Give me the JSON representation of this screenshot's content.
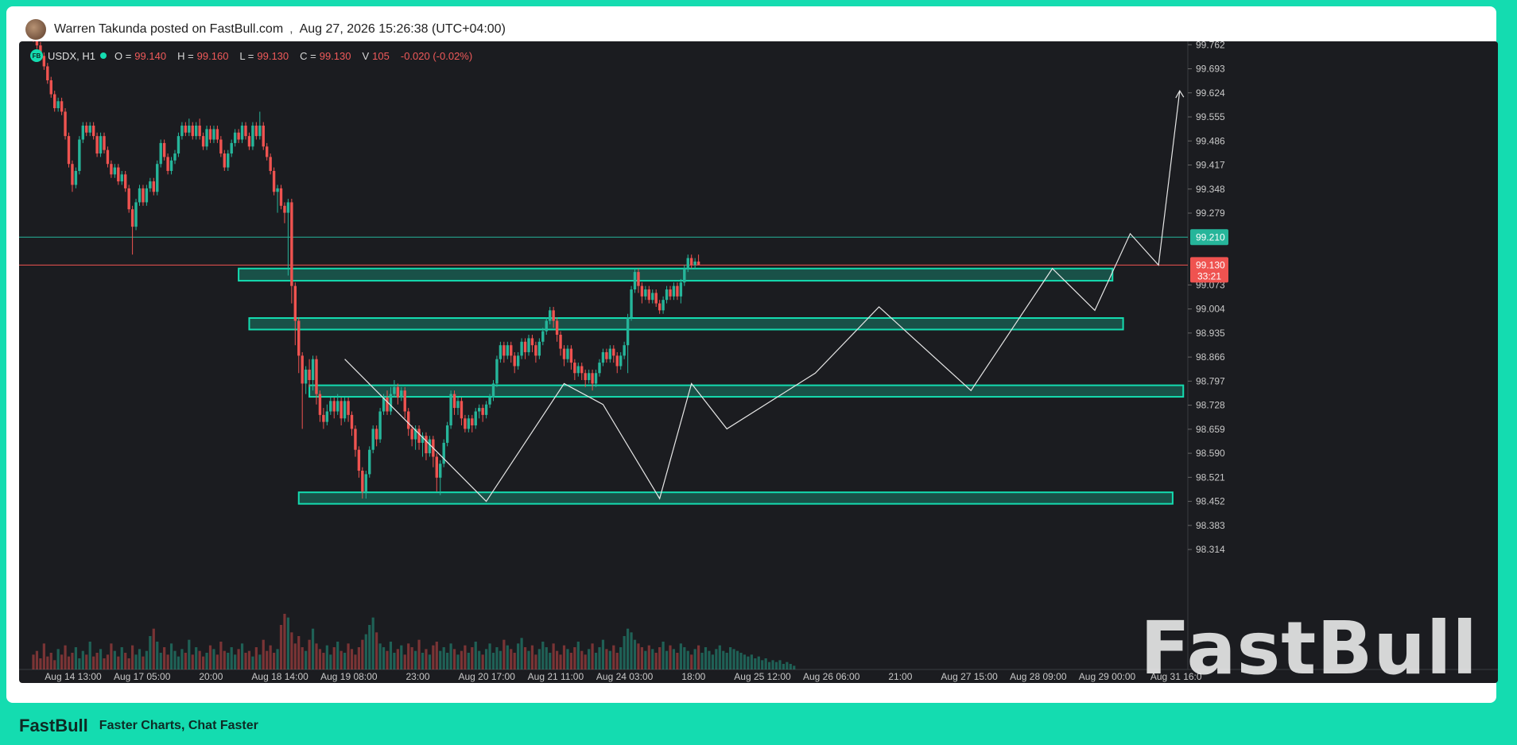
{
  "post": {
    "author_line": "Warren Takunda posted on FastBull.com",
    "separator": ",",
    "timestamp": "Aug 27, 2026 15:26:38 (UTC+04:00)"
  },
  "legend": {
    "symbol": "USDX, H1",
    "open_label": "O =",
    "open": "99.140",
    "high_label": "H =",
    "high": "99.160",
    "low_label": "L =",
    "low": "99.130",
    "close_label": "C =",
    "close": "99.130",
    "volume_label": "V",
    "volume": "105",
    "change": "-0.020 (-0.02%)"
  },
  "watermark": "FastBull",
  "footer": {
    "brand": "FastBull",
    "tagline": "Faster Charts, Chat Faster"
  },
  "colors": {
    "up": "#26b59a",
    "down": "#ef5350",
    "zone": "#14dcb0",
    "accent": "#14dcb0"
  },
  "chart_data": {
    "type": "candlestick",
    "symbol": "USDX",
    "interval": "H1",
    "y_ticks": [
      "99.762",
      "99.693",
      "99.624",
      "99.555",
      "99.486",
      "99.417",
      "99.348",
      "99.279",
      "99.073",
      "99.004",
      "98.935",
      "98.866",
      "98.797",
      "98.728",
      "98.659",
      "98.590",
      "98.521",
      "98.452",
      "98.383",
      "98.314"
    ],
    "ylim": [
      98.28,
      99.79
    ],
    "x_ticks": [
      "Aug 14 13:00",
      "Aug 17 05:00",
      "20:00",
      "Aug 18 14:00",
      "Aug 19 08:00",
      "23:00",
      "Aug 20 17:00",
      "Aug 21 11:00",
      "Aug 24 03:00",
      "18:00",
      "Aug 25 12:00",
      "Aug 26 06:00",
      "21:00",
      "Aug 27 15:00",
      "Aug 28 09:00",
      "Aug 29 00:00",
      "Aug 31 16:0"
    ],
    "price_lines": [
      {
        "value": 99.21,
        "label": "99.210",
        "color": "#26b59a"
      },
      {
        "value": 99.13,
        "label": "99.130",
        "sublabel": "33:21",
        "color": "#ef5350"
      }
    ],
    "zones": [
      {
        "from_bar": 58,
        "to_bar": 305,
        "low": 99.085,
        "high": 99.12
      },
      {
        "from_bar": 61,
        "to_bar": 308,
        "low": 98.945,
        "high": 98.978
      },
      {
        "from_bar": 78,
        "to_bar": 325,
        "low": 98.752,
        "high": 98.785
      },
      {
        "from_bar": 75,
        "to_bar": 322,
        "low": 98.445,
        "high": 98.478
      }
    ],
    "path": [
      [
        88,
        98.86
      ],
      [
        128,
        98.452
      ],
      [
        150,
        98.79
      ],
      [
        161,
        98.73
      ],
      [
        177,
        98.46
      ],
      [
        186,
        98.79
      ],
      [
        196,
        98.66
      ],
      [
        221,
        98.82
      ],
      [
        239,
        99.01
      ],
      [
        265,
        98.77
      ],
      [
        288,
        99.12
      ],
      [
        300,
        99.0
      ],
      [
        310,
        99.22
      ],
      [
        318,
        99.13
      ],
      [
        324,
        99.63
      ]
    ],
    "candles": [
      [
        99.8,
        99.78,
        99.81,
        99.77
      ],
      [
        99.78,
        99.76,
        99.79,
        99.75
      ],
      [
        99.76,
        99.73,
        99.77,
        99.72
      ],
      [
        99.73,
        99.7,
        99.74,
        99.69
      ],
      [
        99.7,
        99.66,
        99.71,
        99.65
      ],
      [
        99.66,
        99.62,
        99.67,
        99.61
      ],
      [
        99.62,
        99.58,
        99.63,
        99.57
      ],
      [
        99.58,
        99.6,
        99.61,
        99.57
      ],
      [
        99.6,
        99.57,
        99.61,
        99.56
      ],
      [
        99.57,
        99.5,
        99.58,
        99.49
      ],
      [
        99.5,
        99.42,
        99.51,
        99.41
      ],
      [
        99.42,
        99.36,
        99.43,
        99.34
      ],
      [
        99.36,
        99.4,
        99.41,
        99.35
      ],
      [
        99.4,
        99.49,
        99.5,
        99.39
      ],
      [
        99.49,
        99.53,
        99.54,
        99.48
      ],
      [
        99.53,
        99.51,
        99.54,
        99.5
      ],
      [
        99.51,
        99.53,
        99.54,
        99.5
      ],
      [
        99.53,
        99.5,
        99.54,
        99.49
      ],
      [
        99.5,
        99.45,
        99.51,
        99.44
      ],
      [
        99.45,
        99.5,
        99.51,
        99.44
      ],
      [
        99.5,
        99.46,
        99.51,
        99.45
      ],
      [
        99.46,
        99.42,
        99.47,
        99.41
      ],
      [
        99.42,
        99.39,
        99.43,
        99.38
      ],
      [
        99.39,
        99.41,
        99.42,
        99.38
      ],
      [
        99.41,
        99.37,
        99.42,
        99.36
      ],
      [
        99.37,
        99.39,
        99.4,
        99.36
      ],
      [
        99.39,
        99.35,
        99.4,
        99.34
      ],
      [
        99.35,
        99.29,
        99.36,
        99.28
      ],
      [
        99.29,
        99.24,
        99.3,
        99.16
      ],
      [
        99.24,
        99.31,
        99.32,
        99.23
      ],
      [
        99.31,
        99.35,
        99.36,
        99.3
      ],
      [
        99.35,
        99.31,
        99.36,
        99.3
      ],
      [
        99.31,
        99.35,
        99.36,
        99.3
      ],
      [
        99.35,
        99.37,
        99.38,
        99.34
      ],
      [
        99.37,
        99.34,
        99.38,
        99.33
      ],
      [
        99.34,
        99.42,
        99.43,
        99.33
      ],
      [
        99.42,
        99.48,
        99.49,
        99.41
      ],
      [
        99.48,
        99.44,
        99.49,
        99.43
      ],
      [
        99.44,
        99.4,
        99.45,
        99.39
      ],
      [
        99.4,
        99.43,
        99.44,
        99.39
      ],
      [
        99.43,
        99.45,
        99.46,
        99.42
      ],
      [
        99.45,
        99.5,
        99.51,
        99.44
      ],
      [
        99.5,
        99.53,
        99.54,
        99.49
      ],
      [
        99.53,
        99.51,
        99.54,
        99.5
      ],
      [
        99.51,
        99.53,
        99.55,
        99.5
      ],
      [
        99.53,
        99.5,
        99.54,
        99.49
      ],
      [
        99.5,
        99.53,
        99.54,
        99.49
      ],
      [
        99.53,
        99.5,
        99.55,
        99.49
      ],
      [
        99.5,
        99.47,
        99.51,
        99.46
      ],
      [
        99.47,
        99.52,
        99.53,
        99.46
      ],
      [
        99.52,
        99.49,
        99.53,
        99.48
      ],
      [
        99.49,
        99.52,
        99.53,
        99.48
      ],
      [
        99.52,
        99.49,
        99.53,
        99.48
      ],
      [
        99.49,
        99.45,
        99.5,
        99.44
      ],
      [
        99.45,
        99.41,
        99.46,
        99.4
      ],
      [
        99.41,
        99.45,
        99.46,
        99.4
      ],
      [
        99.45,
        99.48,
        99.49,
        99.44
      ],
      [
        99.48,
        99.51,
        99.52,
        99.47
      ],
      [
        99.51,
        99.49,
        99.52,
        99.48
      ],
      [
        99.49,
        99.53,
        99.54,
        99.48
      ],
      [
        99.53,
        99.5,
        99.54,
        99.49
      ],
      [
        99.5,
        99.47,
        99.51,
        99.46
      ],
      [
        99.47,
        99.53,
        99.54,
        99.46
      ],
      [
        99.53,
        99.5,
        99.54,
        99.49
      ],
      [
        99.5,
        99.53,
        99.57,
        99.49
      ],
      [
        99.53,
        99.47,
        99.54,
        99.46
      ],
      [
        99.47,
        99.44,
        99.48,
        99.43
      ],
      [
        99.44,
        99.4,
        99.45,
        99.39
      ],
      [
        99.4,
        99.34,
        99.41,
        99.33
      ],
      [
        99.34,
        99.35,
        99.36,
        99.28
      ],
      [
        99.35,
        99.3,
        99.36,
        99.29
      ],
      [
        99.3,
        99.28,
        99.31,
        99.25
      ],
      [
        99.28,
        99.31,
        99.32,
        99.1
      ],
      [
        99.31,
        99.07,
        99.32,
        99.02
      ],
      [
        99.07,
        98.97,
        99.08,
        98.9
      ],
      [
        98.97,
        98.87,
        98.98,
        98.82
      ],
      [
        98.87,
        98.79,
        98.88,
        98.66
      ],
      [
        98.79,
        98.83,
        98.84,
        98.76
      ],
      [
        98.83,
        98.8,
        98.86,
        98.78
      ],
      [
        98.8,
        98.86,
        98.87,
        98.77
      ],
      [
        98.86,
        98.76,
        98.87,
        98.73
      ],
      [
        98.76,
        98.7,
        98.77,
        98.68
      ],
      [
        98.7,
        98.68,
        98.72,
        98.66
      ],
      [
        98.68,
        98.71,
        98.73,
        98.67
      ],
      [
        98.71,
        98.74,
        98.75,
        98.7
      ],
      [
        98.74,
        98.71,
        98.75,
        98.69
      ],
      [
        98.71,
        98.74,
        98.76,
        98.7
      ],
      [
        98.74,
        98.69,
        98.75,
        98.67
      ],
      [
        98.69,
        98.74,
        98.75,
        98.68
      ],
      [
        98.74,
        98.7,
        98.75,
        98.68
      ],
      [
        98.7,
        98.66,
        98.71,
        98.64
      ],
      [
        98.66,
        98.6,
        98.67,
        98.58
      ],
      [
        98.6,
        98.54,
        98.61,
        98.52
      ],
      [
        98.54,
        98.48,
        98.55,
        98.46
      ],
      [
        98.48,
        98.53,
        98.54,
        98.46
      ],
      [
        98.53,
        98.6,
        98.61,
        98.52
      ],
      [
        98.6,
        98.66,
        98.67,
        98.59
      ],
      [
        98.66,
        98.63,
        98.67,
        98.61
      ],
      [
        98.63,
        98.71,
        98.72,
        98.62
      ],
      [
        98.71,
        98.75,
        98.76,
        98.7
      ],
      [
        98.75,
        98.71,
        98.77,
        98.7
      ],
      [
        98.71,
        98.76,
        98.78,
        98.7
      ],
      [
        98.76,
        98.78,
        98.8,
        98.75
      ],
      [
        98.78,
        98.75,
        98.79,
        98.73
      ],
      [
        98.75,
        98.77,
        98.78,
        98.74
      ],
      [
        98.77,
        98.71,
        98.78,
        98.69
      ],
      [
        98.71,
        98.66,
        98.72,
        98.64
      ],
      [
        98.66,
        98.63,
        98.67,
        98.61
      ],
      [
        98.63,
        98.66,
        98.67,
        98.6
      ],
      [
        98.66,
        98.62,
        98.67,
        98.6
      ],
      [
        98.62,
        98.64,
        98.65,
        98.58
      ],
      [
        98.64,
        98.59,
        98.65,
        98.57
      ],
      [
        98.59,
        98.63,
        98.64,
        98.58
      ],
      [
        98.63,
        98.58,
        98.64,
        98.55
      ],
      [
        98.58,
        98.52,
        98.59,
        98.48
      ],
      [
        98.52,
        98.56,
        98.57,
        98.47
      ],
      [
        98.56,
        98.62,
        98.63,
        98.55
      ],
      [
        98.62,
        98.67,
        98.68,
        98.61
      ],
      [
        98.67,
        98.76,
        98.77,
        98.66
      ],
      [
        98.76,
        98.72,
        98.77,
        98.7
      ],
      [
        98.72,
        98.74,
        98.75,
        98.7
      ],
      [
        98.74,
        98.69,
        98.75,
        98.67
      ],
      [
        98.69,
        98.66,
        98.7,
        98.65
      ],
      [
        98.66,
        98.69,
        98.7,
        98.65
      ],
      [
        98.69,
        98.67,
        98.7,
        98.65
      ],
      [
        98.67,
        98.71,
        98.72,
        98.66
      ],
      [
        98.71,
        98.72,
        98.73,
        98.69
      ],
      [
        98.72,
        98.7,
        98.73,
        98.68
      ],
      [
        98.7,
        98.73,
        98.74,
        98.69
      ],
      [
        98.73,
        98.75,
        98.76,
        98.72
      ],
      [
        98.75,
        98.79,
        98.8,
        98.74
      ],
      [
        98.79,
        98.86,
        98.87,
        98.78
      ],
      [
        98.86,
        98.9,
        98.91,
        98.85
      ],
      [
        98.9,
        98.87,
        98.91,
        98.85
      ],
      [
        98.87,
        98.9,
        98.91,
        98.86
      ],
      [
        98.9,
        98.87,
        98.91,
        98.85
      ],
      [
        98.87,
        98.84,
        98.88,
        98.82
      ],
      [
        98.84,
        98.87,
        98.88,
        98.83
      ],
      [
        98.87,
        98.91,
        98.92,
        98.86
      ],
      [
        98.91,
        98.88,
        98.92,
        98.86
      ],
      [
        98.88,
        98.92,
        98.93,
        98.87
      ],
      [
        98.92,
        98.9,
        98.93,
        98.88
      ],
      [
        98.9,
        98.87,
        98.91,
        98.85
      ],
      [
        98.87,
        98.91,
        98.92,
        98.86
      ],
      [
        98.91,
        98.94,
        98.95,
        98.9
      ],
      [
        98.94,
        98.97,
        98.98,
        98.93
      ],
      [
        98.97,
        99.0,
        99.01,
        98.96
      ],
      [
        99.0,
        98.97,
        99.01,
        98.95
      ],
      [
        98.97,
        98.93,
        98.98,
        98.91
      ],
      [
        98.93,
        98.89,
        98.94,
        98.87
      ],
      [
        98.89,
        98.86,
        98.9,
        98.84
      ],
      [
        98.86,
        98.89,
        98.9,
        98.85
      ],
      [
        98.89,
        98.85,
        98.9,
        98.83
      ],
      [
        98.85,
        98.82,
        98.86,
        98.8
      ],
      [
        98.82,
        98.84,
        98.85,
        98.81
      ],
      [
        98.84,
        98.82,
        98.85,
        98.8
      ],
      [
        98.82,
        98.8,
        98.83,
        98.78
      ],
      [
        98.8,
        98.82,
        98.83,
        98.79
      ],
      [
        98.82,
        98.79,
        98.83,
        98.77
      ],
      [
        98.79,
        98.82,
        98.83,
        98.78
      ],
      [
        98.82,
        98.85,
        98.86,
        98.81
      ],
      [
        98.85,
        98.88,
        98.89,
        98.84
      ],
      [
        98.88,
        98.86,
        98.89,
        98.85
      ],
      [
        98.86,
        98.89,
        98.9,
        98.85
      ],
      [
        98.89,
        98.87,
        98.9,
        98.85
      ],
      [
        98.87,
        98.84,
        98.88,
        98.82
      ],
      [
        98.84,
        98.87,
        98.88,
        98.83
      ],
      [
        98.87,
        98.9,
        98.91,
        98.86
      ],
      [
        98.9,
        98.98,
        98.99,
        98.82
      ],
      [
        98.98,
        99.06,
        99.07,
        98.97
      ],
      [
        99.06,
        99.11,
        99.12,
        99.05
      ],
      [
        99.11,
        99.07,
        99.12,
        99.05
      ],
      [
        99.07,
        99.04,
        99.08,
        99.02
      ],
      [
        99.04,
        99.06,
        99.07,
        99.03
      ],
      [
        99.06,
        99.03,
        99.07,
        99.02
      ],
      [
        99.03,
        99.05,
        99.06,
        99.02
      ],
      [
        99.05,
        99.02,
        99.06,
        99.01
      ],
      [
        99.02,
        99.0,
        99.03,
        98.99
      ],
      [
        99.0,
        99.03,
        99.04,
        98.99
      ],
      [
        99.03,
        99.06,
        99.07,
        99.02
      ],
      [
        99.06,
        99.04,
        99.07,
        99.03
      ],
      [
        99.04,
        99.07,
        99.08,
        99.03
      ],
      [
        99.07,
        99.04,
        99.08,
        99.03
      ],
      [
        99.04,
        99.08,
        99.09,
        99.02
      ],
      [
        99.08,
        99.12,
        99.13,
        99.07
      ],
      [
        99.12,
        99.15,
        99.16,
        99.11
      ],
      [
        99.15,
        99.13,
        99.16,
        99.12
      ],
      [
        99.13,
        99.14,
        99.15,
        99.12
      ],
      [
        99.14,
        99.13,
        99.16,
        99.13
      ]
    ],
    "volume": [
      8,
      10,
      6,
      14,
      7,
      9,
      5,
      11,
      8,
      13,
      7,
      9,
      12,
      6,
      10,
      8,
      15,
      7,
      9,
      11,
      6,
      8,
      14,
      10,
      7,
      12,
      9,
      6,
      13,
      8,
      11,
      7,
      10,
      18,
      22,
      15,
      9,
      12,
      8,
      14,
      10,
      7,
      11,
      9,
      16,
      8,
      12,
      10,
      7,
      9,
      13,
      11,
      8,
      15,
      10,
      9,
      12,
      8,
      11,
      14,
      9,
      10,
      7,
      12,
      8,
      16,
      10,
      13,
      9,
      11,
      24,
      30,
      28,
      20,
      14,
      18,
      12,
      10,
      16,
      22,
      14,
      11,
      9,
      13,
      8,
      12,
      15,
      10,
      9,
      14,
      11,
      8,
      12,
      16,
      19,
      24,
      28,
      20,
      14,
      12,
      10,
      15,
      9,
      11,
      13,
      8,
      14,
      12,
      10,
      16,
      9,
      11,
      8,
      13,
      15,
      10,
      12,
      9,
      14,
      11,
      8,
      10,
      13,
      9,
      12,
      15,
      10,
      8,
      11,
      14,
      9,
      12,
      10,
      16,
      13,
      11,
      9,
      14,
      17,
      12,
      10,
      13,
      8,
      11,
      15,
      12,
      9,
      14,
      10,
      8,
      13,
      11,
      9,
      12,
      15,
      10,
      8,
      11,
      14,
      9,
      12,
      16,
      11,
      10,
      13,
      9,
      12,
      18,
      22,
      20,
      16,
      14,
      12,
      10,
      13,
      11,
      9,
      12,
      15,
      10,
      13,
      11,
      9,
      14,
      12,
      10,
      8,
      11,
      13,
      9,
      12,
      10,
      8,
      11,
      13,
      10,
      9,
      12,
      11,
      10,
      9,
      8,
      7,
      8,
      6,
      7,
      5,
      6,
      4,
      5,
      4,
      5,
      3,
      4,
      3,
      2
    ]
  }
}
